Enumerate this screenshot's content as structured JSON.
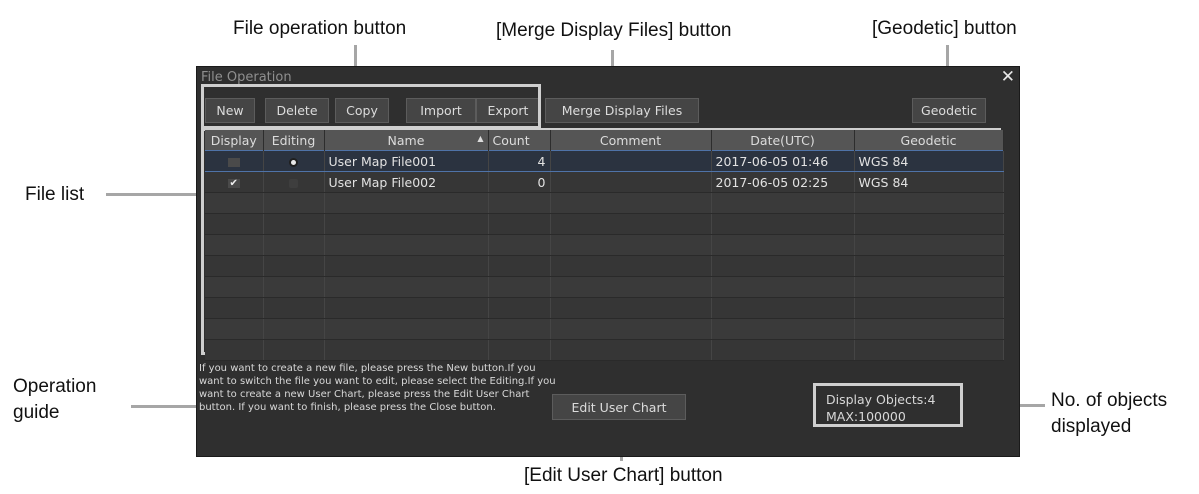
{
  "callouts": {
    "file_operation_button": "File operation button",
    "merge_button": "[Merge Display Files] button",
    "geodetic_button": "[Geodetic] button",
    "file_list": "File list",
    "operation_guide": "Operation\nguide",
    "objects_displayed": "No. of objects\ndisplayed",
    "edit_chart_button": "[Edit User Chart] button"
  },
  "dialog": {
    "title": "File Operation",
    "close": "✕",
    "toolbar": {
      "new": "New",
      "delete": "Delete",
      "copy": "Copy",
      "import": "Import",
      "export": "Export",
      "merge": "Merge Display Files",
      "geodetic": "Geodetic"
    },
    "columns": [
      "Display",
      "Editing",
      "Name",
      "Count",
      "Comment",
      "Date(UTC)",
      "Geodetic"
    ],
    "sort_indicator": "▲",
    "rows": [
      {
        "display": false,
        "editing": true,
        "name": "User Map File001",
        "count": "4",
        "comment": "",
        "date": "2017-06-05 01:46",
        "geodetic": "WGS 84"
      },
      {
        "display": true,
        "editing": false,
        "name": "User Map File002",
        "count": "0",
        "comment": "",
        "date": "2017-06-05 02:25",
        "geodetic": "WGS 84"
      }
    ],
    "guide": "If you want to create a new file, please press the New button.If you want to switch the file you want to edit, please select the Editing.If you want to create a new User Chart, please press the Edit User Chart button. If you want to finish, please press the Close button.",
    "edit_chart": "Edit User Chart",
    "display_objects": "Display Objects:4",
    "max": "MAX:100000"
  }
}
